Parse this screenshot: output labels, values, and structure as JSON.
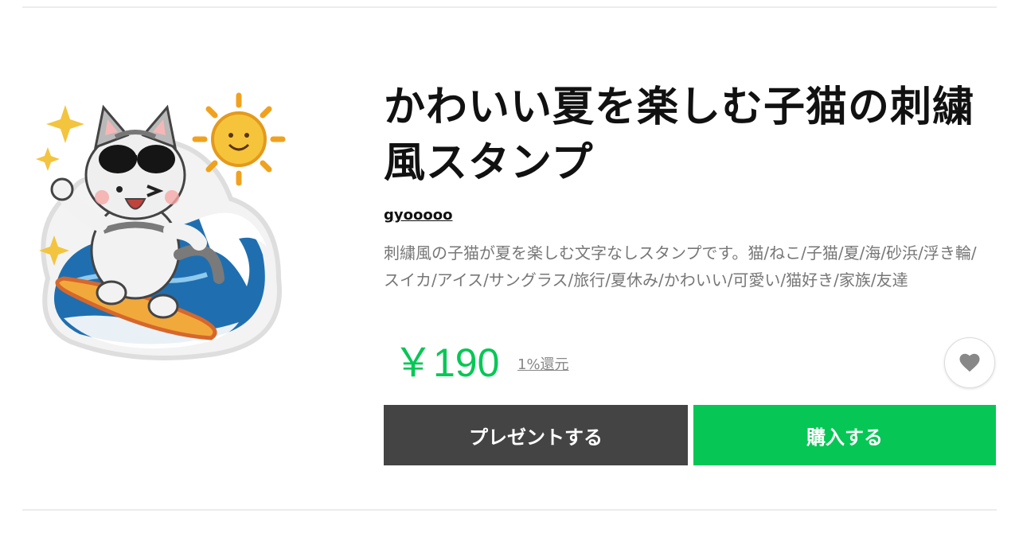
{
  "product": {
    "title": "かわいい夏を楽しむ子猫の刺繍風スタンプ",
    "author": "gyooooo",
    "description": "刺繍風の子猫が夏を楽しむ文字なしスタンプです。猫/ねこ/子猫/夏/海/砂浜/浮き輪/スイカ/アイス/サングラス/旅行/夏休み/かわいい/可愛い/猫好き/家族/友達",
    "price": "￥190",
    "cashback": "1%還元"
  },
  "actions": {
    "present_label": "プレゼントする",
    "buy_label": "購入する"
  },
  "icons": {
    "favorite": "heart-icon",
    "sticker": "surfing-cat-sticker"
  },
  "colors": {
    "accent": "#06c755",
    "present_button": "#444444",
    "heart": "#888888"
  }
}
